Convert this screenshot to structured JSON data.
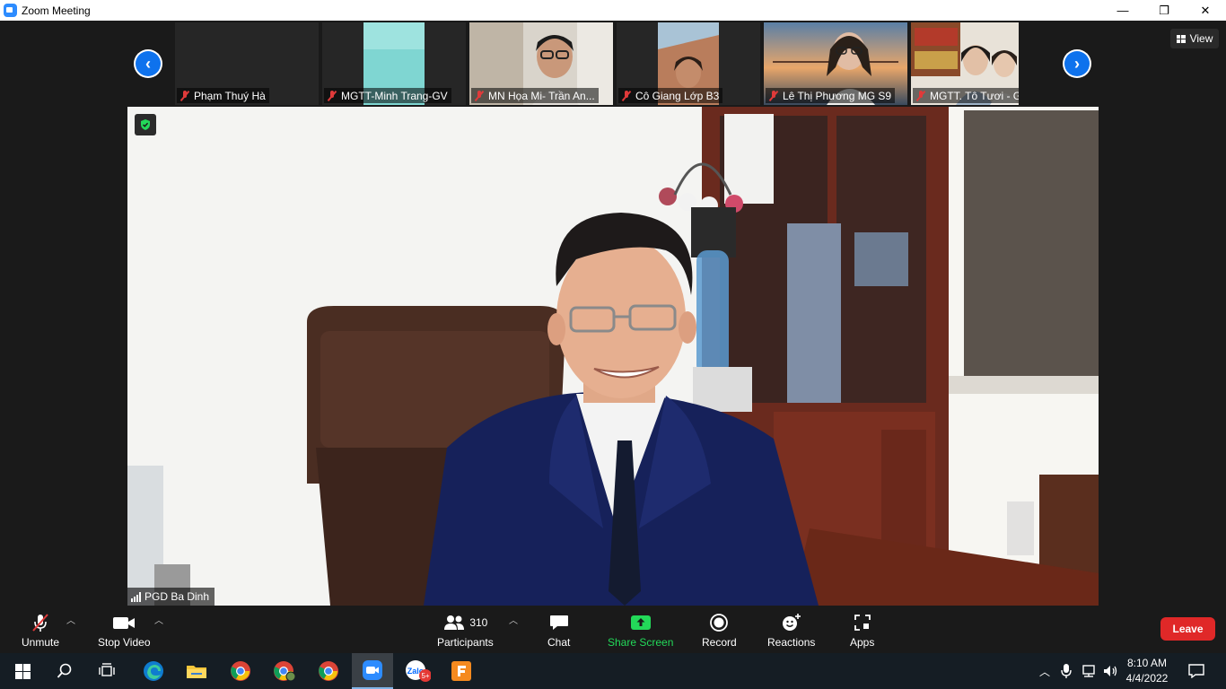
{
  "window": {
    "title": "Zoom Meeting",
    "controls": [
      "—",
      "❐",
      "✕"
    ]
  },
  "thumbnails": [
    {
      "name": "Phạm Thuý Hà"
    },
    {
      "name": "MGTT-Minh Trang-GV"
    },
    {
      "name": "MN Họa Mi- Trần An..."
    },
    {
      "name": "Cô Giang Lớp B3"
    },
    {
      "name": "Lê Thị Phương MG S9"
    },
    {
      "name": "MGTT. Tô Tươi - GV"
    }
  ],
  "view_button": {
    "label": "View"
  },
  "main_speaker": {
    "name": "PGD Ba Dinh"
  },
  "toolbar": {
    "unmute": "Unmute",
    "stop_video": "Stop Video",
    "participants_count": "310",
    "participants": "Participants",
    "chat": "Chat",
    "share_screen": "Share Screen",
    "record": "Record",
    "reactions": "Reactions",
    "apps": "Apps",
    "leave": "Leave"
  },
  "taskbar": {
    "time": "8:10 AM",
    "date": "4/4/2022",
    "zalo_badge": "5+"
  },
  "colors": {
    "accent_blue": "#0e72ed",
    "share_green": "#23d959",
    "leave_red": "#e02828",
    "mute_red": "#e03a3a"
  }
}
